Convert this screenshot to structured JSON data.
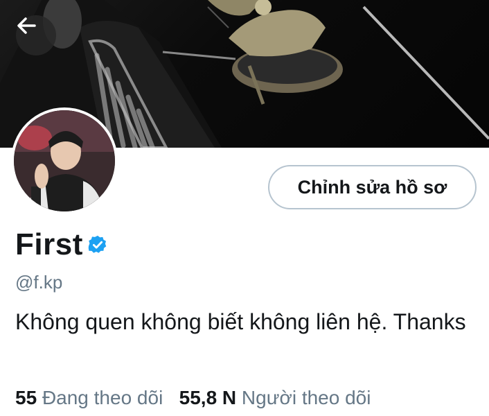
{
  "profile": {
    "name": "First",
    "handle": "@f.kp",
    "bio": "Không quen không biết không liên hệ. Thanks",
    "verified": true,
    "edit_button": "Chỉnh sửa hồ sơ"
  },
  "stats": {
    "following_count": "55",
    "following_label": "Đang theo dõi",
    "followers_count": "55,8 N",
    "followers_label": "Người theo dõi"
  },
  "icons": {
    "back": "arrow-left-icon",
    "verified": "verified-badge-icon"
  },
  "colors": {
    "verified_blue": "#1da1f2",
    "secondary_text": "#657786",
    "button_border": "#b6c4cf"
  }
}
